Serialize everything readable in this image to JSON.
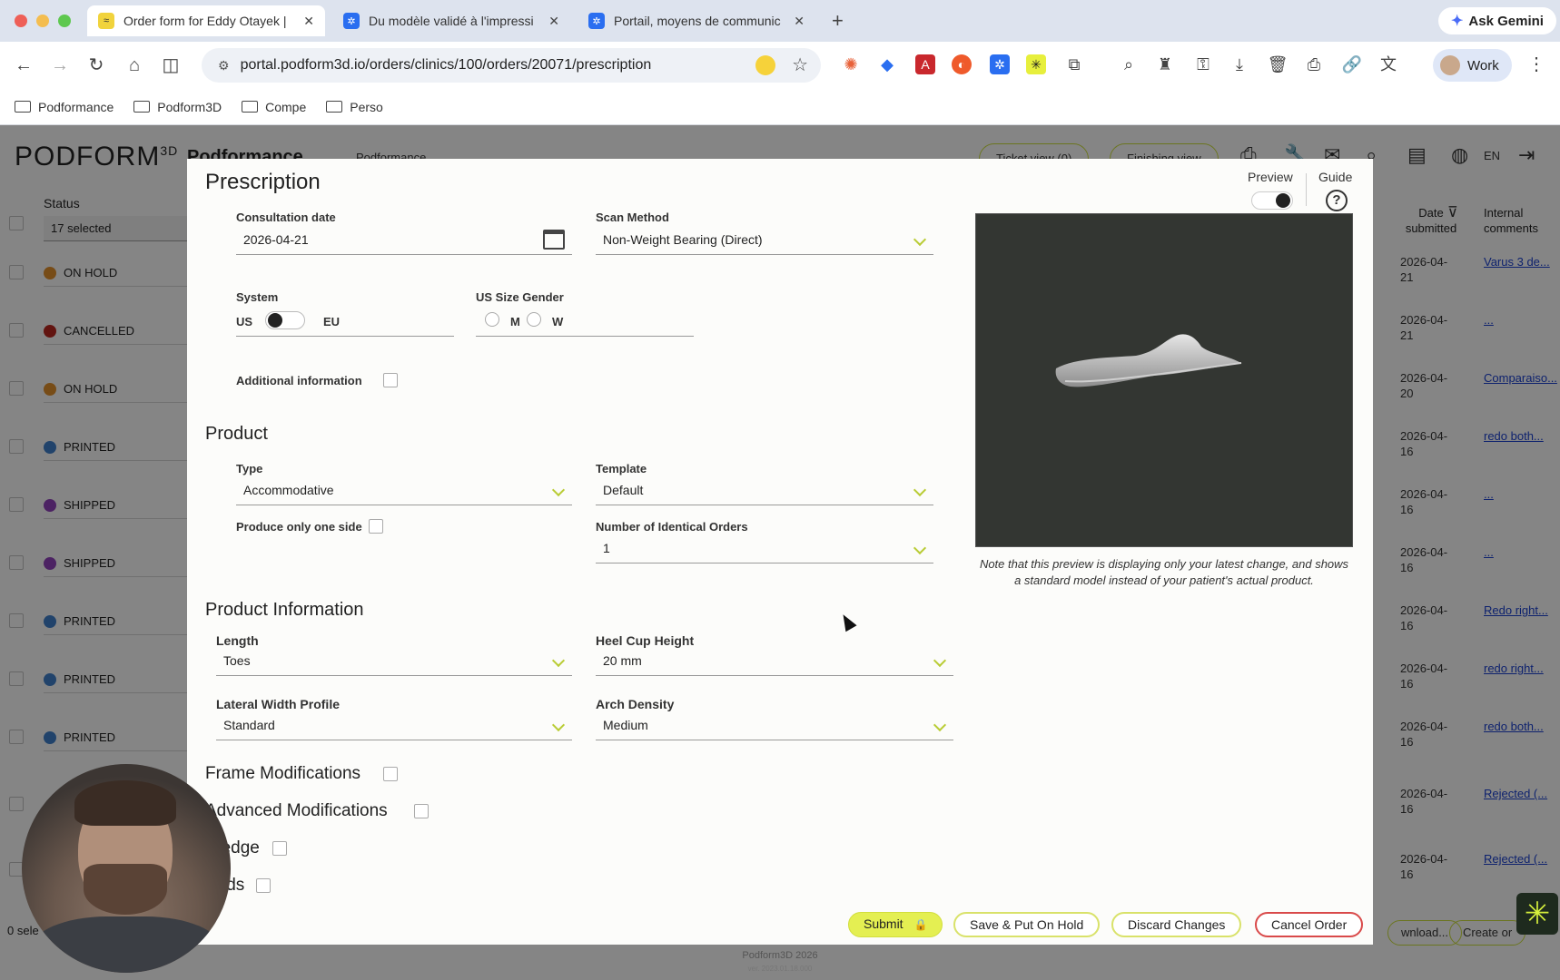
{
  "browser": {
    "tabs": [
      {
        "label": "Order form for Eddy Otayek |",
        "active": true
      },
      {
        "label": "Du modèle validé à l'impressi",
        "active": false
      },
      {
        "label": "Portail, moyens de communic",
        "active": false
      }
    ],
    "ask_gemini": "Ask Gemini",
    "url": "portal.podform3d.io/orders/clinics/100/orders/20071/prescription",
    "profile": "Work",
    "bookmarks": [
      "Podformance",
      "Podform3D",
      "Compe",
      "Perso"
    ]
  },
  "background": {
    "logo": "PODFORM",
    "logo_sup": "3D",
    "title": "Podformance",
    "select_value": "Podformance",
    "header_buttons": [
      "Ticket view (0)",
      "Finishing view"
    ],
    "language": "EN",
    "status_header": "Status",
    "status_selected": "17 selected",
    "col_date": "Date submitted",
    "col_comments": "Internal comments",
    "rows": [
      {
        "status": "ON HOLD",
        "color": "#d98a2b",
        "date": "2026-04-21",
        "comment": "Varus 3 de..."
      },
      {
        "status": "CANCELLED",
        "color": "#b3261e",
        "date": "2026-04-21",
        "comment": "..."
      },
      {
        "status": "ON HOLD",
        "color": "#d98a2b",
        "date": "2026-04-20",
        "comment": "Comparaiso..."
      },
      {
        "status": "PRINTED",
        "color": "#3d7bc4",
        "date": "2026-04-16",
        "comment": "redo both..."
      },
      {
        "status": "SHIPPED",
        "color": "#8a3fb4",
        "date": "2026-04-16",
        "comment": "..."
      },
      {
        "status": "SHIPPED",
        "color": "#8a3fb4",
        "date": "2026-04-16",
        "comment": "..."
      },
      {
        "status": "PRINTED",
        "color": "#3d7bc4",
        "date": "2026-04-16",
        "comment": "Redo right..."
      },
      {
        "status": "PRINTED",
        "color": "#3d7bc4",
        "date": "2026-04-16",
        "comment": "redo right..."
      },
      {
        "status": "PRINTED",
        "color": "#3d7bc4",
        "date": "2026-04-16",
        "comment": "redo both..."
      },
      {
        "status": "",
        "color": "",
        "date": "2026-04-16",
        "comment": "Rejected (..."
      },
      {
        "status": "",
        "color": "",
        "date": "2026-04-16",
        "comment": "Rejected (..."
      }
    ],
    "footer_left": "0 sele",
    "footer_buttons": [
      "wnload...",
      "Create or"
    ],
    "footer_text": "Podform3D 2026",
    "footer_sub": "ver. 2023.01.18.000"
  },
  "modal": {
    "title": "Prescription",
    "preview_label": "Preview",
    "guide_label": "Guide",
    "consultation_date_label": "Consultation date",
    "consultation_date": "2026-04-21",
    "scan_method_label": "Scan Method",
    "scan_method": "Non-Weight Bearing (Direct)",
    "system_label": "System",
    "system_us": "US",
    "system_eu": "EU",
    "size_gender_label": "US Size Gender",
    "gender_m": "M",
    "gender_w": "W",
    "additional_info_label": "Additional information",
    "product_section": "Product",
    "type_label": "Type",
    "type_value": "Accommodative",
    "template_label": "Template",
    "template_value": "Default",
    "one_side_label": "Produce only one side",
    "identical_orders_label": "Number of Identical Orders",
    "identical_orders_value": "1",
    "product_info_section": "Product Information",
    "length_label": "Length",
    "length_value": "Toes",
    "heel_cup_label": "Heel Cup Height",
    "heel_cup_value": "20 mm",
    "lateral_label": "Lateral Width Profile",
    "lateral_value": "Standard",
    "arch_label": "Arch Density",
    "arch_value": "Medium",
    "frame_mods": "Frame Modifications",
    "advanced_mods": "Advanced Modifications",
    "wedge": "Wedge",
    "pads": "Pads",
    "preview_note": "Note that this preview is displaying only your latest change, and shows a standard model instead of your patient's actual product.",
    "buttons": {
      "submit": "Submit",
      "save_hold": "Save & Put On Hold",
      "discard": "Discard Changes",
      "cancel": "Cancel Order"
    }
  }
}
